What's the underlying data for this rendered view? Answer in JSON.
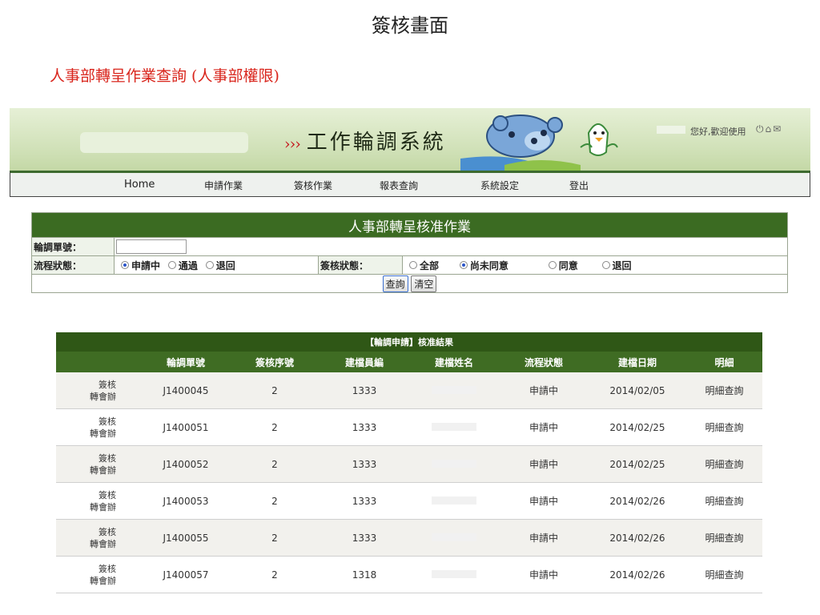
{
  "page_title": "簽核畫面",
  "section_title": "人事部轉呈作業查詢 (人事部權限)",
  "header": {
    "arrows": "›››",
    "app_name": "工作輪調系統",
    "greeting": "您好,歡迎使用",
    "icons": [
      "power-icon",
      "home-icon",
      "mail-icon"
    ]
  },
  "nav": {
    "items": [
      "Home",
      "申請作業",
      "簽核作業",
      "報表查詢",
      "系統設定",
      "登出"
    ]
  },
  "form": {
    "title": "人事部轉呈核准作業",
    "rotation_no_label": "輪調單號：",
    "rotation_no_value": "",
    "flow_status_label": "流程狀態：",
    "flow_status_options": [
      "申請中",
      "通過",
      "退回"
    ],
    "flow_status_selected": "申請中",
    "sign_status_label": "簽核狀態：",
    "sign_status_options": [
      "全部",
      "尚未同意",
      "同意",
      "退回"
    ],
    "sign_status_selected": "尚未同意",
    "query_button": "查詢",
    "clear_button": "清空"
  },
  "results": {
    "caption": "【輪調申請】核准結果",
    "columns": [
      "",
      "輪調單號",
      "簽核序號",
      "建檔員編",
      "建檔姓名",
      "流程狀態",
      "建檔日期",
      "明細"
    ],
    "action_sign": "簽核",
    "action_review": "轉會辦",
    "detail_label": "明細查詢",
    "rows": [
      {
        "no": "J1400045",
        "seq": "2",
        "emp": "1333",
        "status": "申請中",
        "date": "2014/02/05"
      },
      {
        "no": "J1400051",
        "seq": "2",
        "emp": "1333",
        "status": "申請中",
        "date": "2014/02/25"
      },
      {
        "no": "J1400052",
        "seq": "2",
        "emp": "1333",
        "status": "申請中",
        "date": "2014/02/25"
      },
      {
        "no": "J1400053",
        "seq": "2",
        "emp": "1333",
        "status": "申請中",
        "date": "2014/02/26"
      },
      {
        "no": "J1400055",
        "seq": "2",
        "emp": "1333",
        "status": "申請中",
        "date": "2014/02/26"
      },
      {
        "no": "J1400057",
        "seq": "2",
        "emp": "1318",
        "status": "申請中",
        "date": "2014/02/26"
      }
    ]
  }
}
